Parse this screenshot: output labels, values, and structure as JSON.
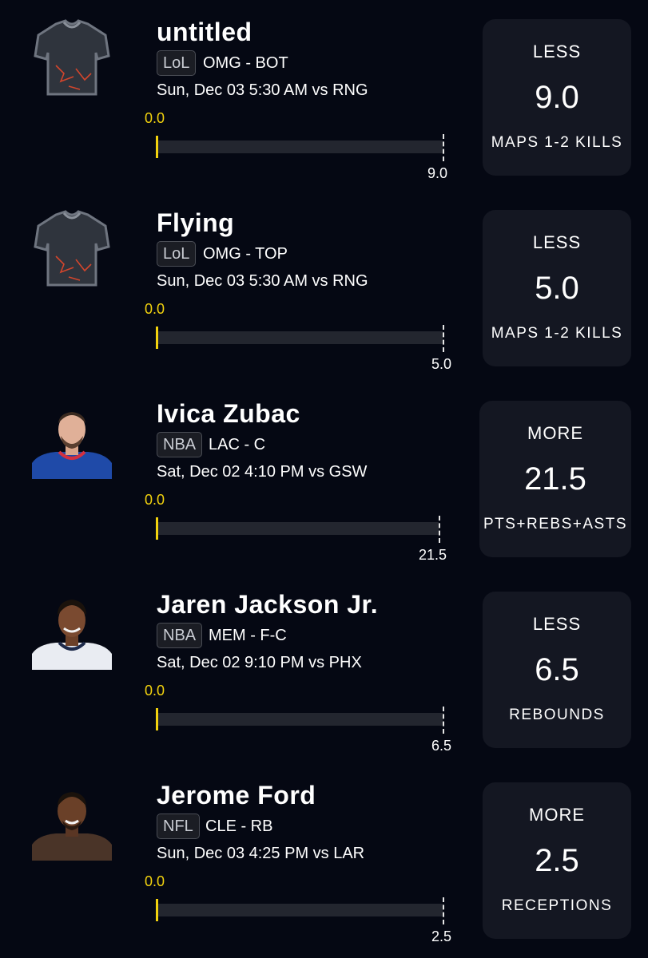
{
  "picks": [
    {
      "name": "untitled",
      "league": "LoL",
      "team_pos": "OMG - BOT",
      "game": "Sun, Dec 03 5:30 AM  vs RNG",
      "current": "0.0",
      "line": "9.0",
      "direction": "LESS",
      "stat": "MAPS 1-2 KILLS",
      "avatar_icon": "jersey-icon"
    },
    {
      "name": "Flying",
      "league": "LoL",
      "team_pos": "OMG - TOP",
      "game": "Sun, Dec 03 5:30 AM  vs RNG",
      "current": "0.0",
      "line": "5.0",
      "direction": "LESS",
      "stat": "MAPS 1-2 KILLS",
      "avatar_icon": "jersey-icon"
    },
    {
      "name": "Ivica Zubac",
      "league": "NBA",
      "team_pos": "LAC - C",
      "game": "Sat, Dec 02 4:10 PM  vs GSW",
      "current": "0.0",
      "line": "21.5",
      "direction": "MORE",
      "stat": "PTS+REBS+ASTS",
      "avatar_icon": "player-photo-icon"
    },
    {
      "name": "Jaren Jackson Jr.",
      "league": "NBA",
      "team_pos": "MEM - F-C",
      "game": "Sat, Dec 02 9:10 PM  vs PHX",
      "current": "0.0",
      "line": "6.5",
      "direction": "LESS",
      "stat": "REBOUNDS",
      "avatar_icon": "player-photo-icon"
    },
    {
      "name": "Jerome Ford",
      "league": "NFL",
      "team_pos": "CLE - RB",
      "game": "Sun, Dec 03 4:25 PM  vs LAR",
      "current": "0.0",
      "line": "2.5",
      "direction": "MORE",
      "stat": "RECEPTIONS",
      "avatar_icon": "player-photo-icon"
    }
  ],
  "colors": {
    "background": "#050813",
    "card": "#141722",
    "progress_current": "#f2d20e",
    "track": "#23262f"
  }
}
